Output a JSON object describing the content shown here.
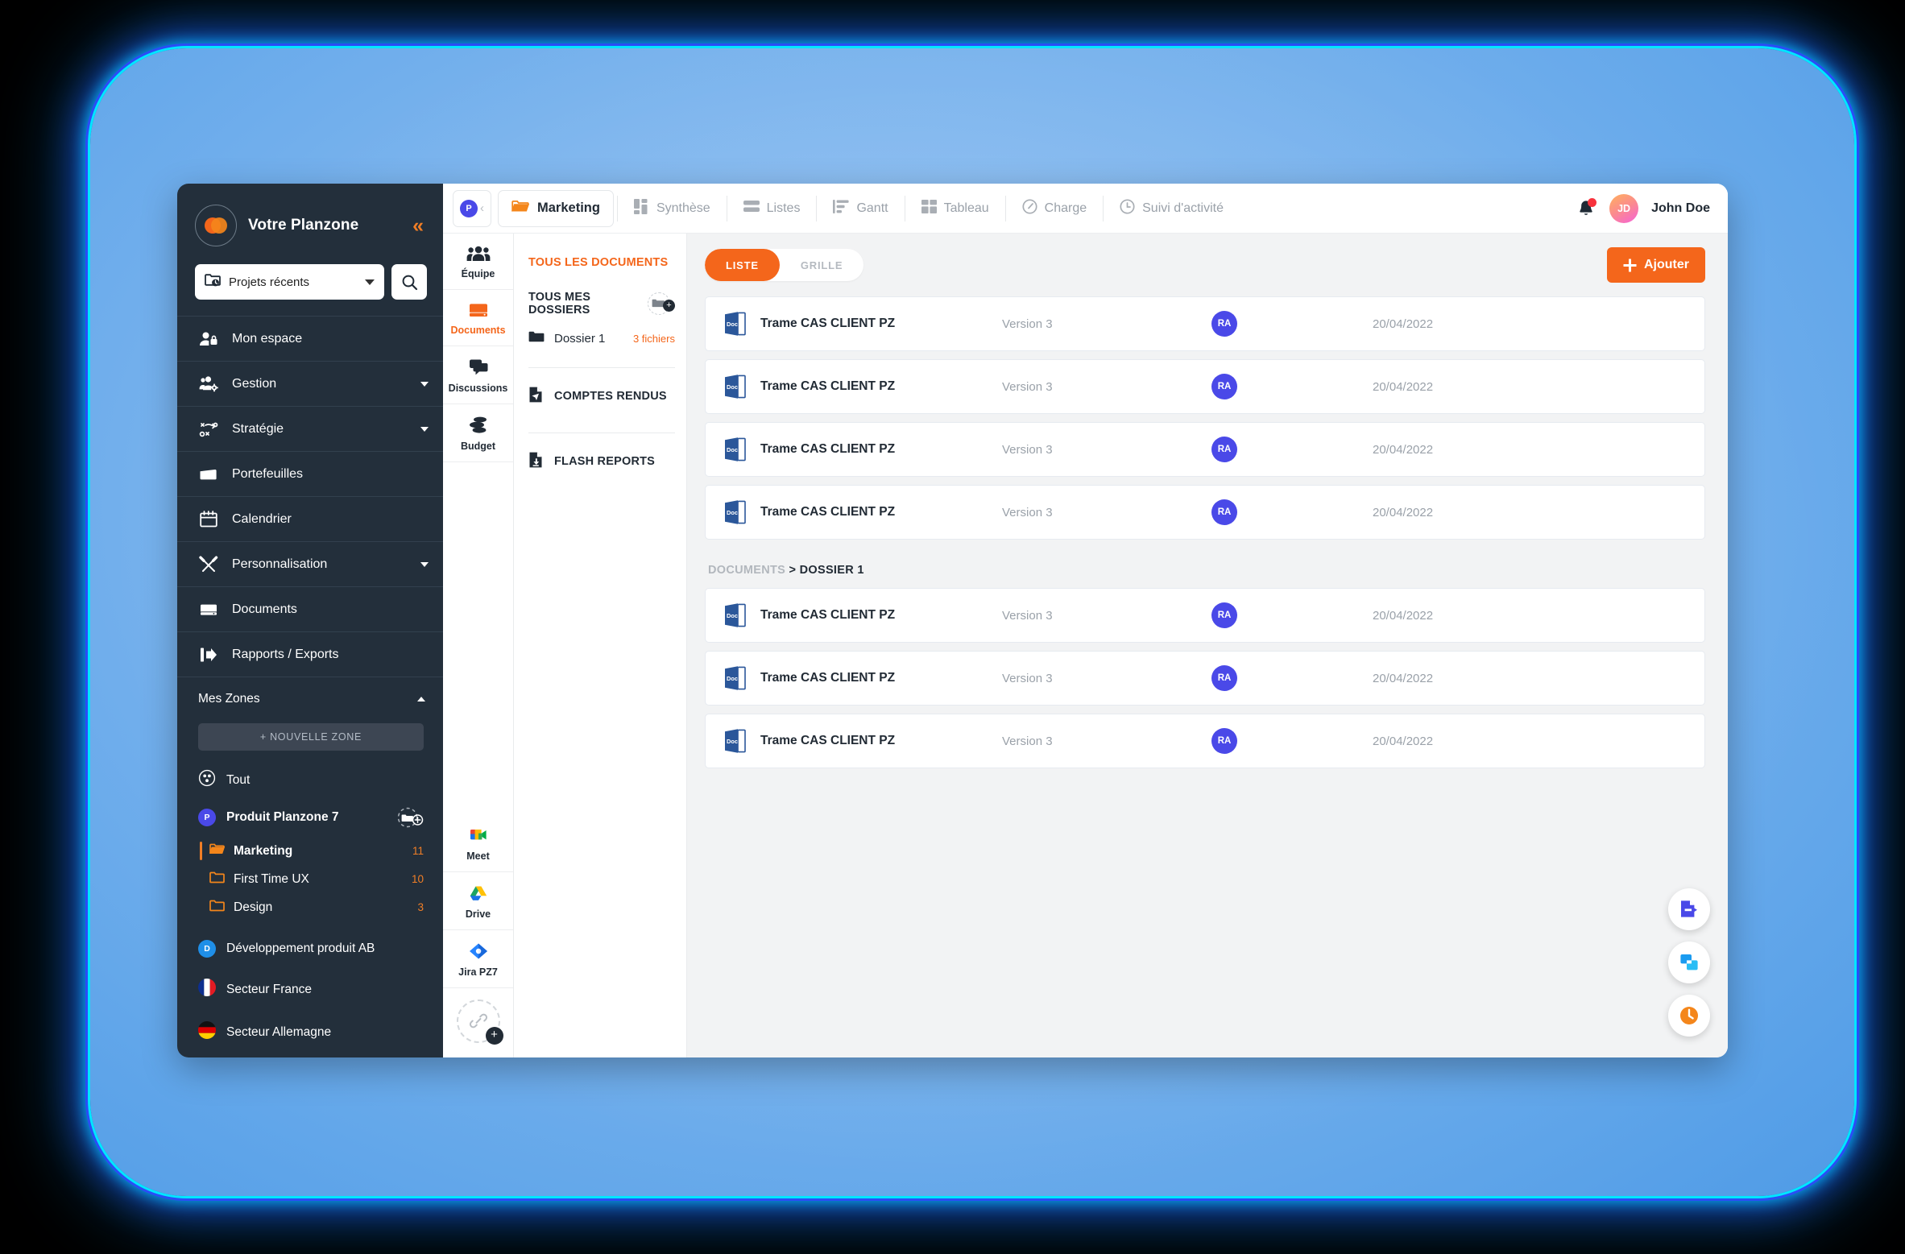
{
  "sidebar": {
    "brand_title": "Votre Planzone",
    "collapse_icon": "double-chevron-left-icon",
    "project_select": {
      "value": "Projets récents"
    },
    "search_placeholder": "Rechercher",
    "items": [
      {
        "label": "Mon espace",
        "icon": "user-lock-icon",
        "expandable": false
      },
      {
        "label": "Gestion",
        "icon": "users-gear-icon",
        "expandable": true
      },
      {
        "label": "Stratégie",
        "icon": "strategy-icon",
        "expandable": true
      },
      {
        "label": "Portefeuilles",
        "icon": "briefcase-icon",
        "expandable": false
      },
      {
        "label": "Calendrier",
        "icon": "calendar-icon",
        "expandable": false
      },
      {
        "label": "Personnalisation",
        "icon": "tools-icon",
        "expandable": true
      },
      {
        "label": "Documents",
        "icon": "documents-icon",
        "expandable": false
      },
      {
        "label": "Rapports / Exports",
        "icon": "export-icon",
        "expandable": false
      }
    ],
    "zones_header": "Mes Zones",
    "new_zone_label": "+ NOUVELLE ZONE",
    "zones": [
      {
        "label": "Tout",
        "badge": "",
        "badge_color": "",
        "type": "all"
      },
      {
        "label": "Produit Planzone 7",
        "badge": "P",
        "badge_color": "#4a49e8",
        "type": "project",
        "has_add": true
      },
      {
        "label": "Développement produit AB",
        "badge": "D",
        "badge_color": "#1f8fe8",
        "type": "project"
      },
      {
        "label": "Secteur France",
        "badge": "",
        "badge_color": "",
        "type": "flag-fr"
      },
      {
        "label": "Secteur Allemagne",
        "badge": "",
        "badge_color": "",
        "type": "flag-de"
      }
    ],
    "folders": [
      {
        "label": "Marketing",
        "count": "11",
        "active": true
      },
      {
        "label": "First Time UX",
        "count": "10",
        "active": false
      },
      {
        "label": "Design",
        "count": "3",
        "active": false
      }
    ]
  },
  "topnav": {
    "chip_initial": "P",
    "chip_chevron": "‹",
    "active_tab": "Marketing",
    "tabs": [
      {
        "label": "Synthèse",
        "icon": "dashboard-icon"
      },
      {
        "label": "Listes",
        "icon": "list-icon"
      },
      {
        "label": "Gantt",
        "icon": "gantt-icon"
      },
      {
        "label": "Tableau",
        "icon": "board-icon"
      },
      {
        "label": "Charge",
        "icon": "gauge-icon"
      },
      {
        "label": "Suivi d'activité",
        "icon": "clock-icon"
      }
    ],
    "notifications_icon": "bell-icon",
    "has_notification": true,
    "user_initials": "JD",
    "user_name": "John Doe"
  },
  "rail": {
    "items": [
      {
        "label": "Équipe",
        "icon": "team-icon",
        "active": false
      },
      {
        "label": "Documents",
        "icon": "documents-icon",
        "active": true
      },
      {
        "label": "Discussions",
        "icon": "chat-icon",
        "active": false
      },
      {
        "label": "Budget",
        "icon": "coins-icon",
        "active": false
      }
    ],
    "apps": [
      {
        "label": "Meet",
        "icon": "google-meet-icon"
      },
      {
        "label": "Drive",
        "icon": "google-drive-icon"
      },
      {
        "label": "Jira PZ7",
        "icon": "jira-icon"
      }
    ],
    "add_app_icon": "link-plus-icon"
  },
  "tree": {
    "all_documents": "TOUS LES DOCUMENTS",
    "all_folders": "TOUS MES DOSSIERS",
    "add_folder_icon": "add-folder-icon",
    "folders": [
      {
        "name": "Dossier 1",
        "count": "3 fichiers"
      }
    ],
    "links": [
      {
        "label": "COMPTES RENDUS",
        "icon": "report-send-icon"
      },
      {
        "label": "FLASH REPORTS",
        "icon": "report-download-icon"
      }
    ]
  },
  "toolbar": {
    "view_list": "LISTE",
    "view_grid": "GRILLE",
    "add_label": "Ajouter",
    "add_icon": "plus-icon"
  },
  "documents": {
    "root_rows": [
      {
        "icon": "word-doc-icon",
        "name": "Trame CAS CLIENT PZ",
        "version": "Version 3",
        "author": "RA",
        "date": "20/04/2022"
      },
      {
        "icon": "word-doc-icon",
        "name": "Trame CAS CLIENT PZ",
        "version": "Version 3",
        "author": "RA",
        "date": "20/04/2022"
      },
      {
        "icon": "word-doc-icon",
        "name": "Trame CAS CLIENT PZ",
        "version": "Version 3",
        "author": "RA",
        "date": "20/04/2022"
      },
      {
        "icon": "word-doc-icon",
        "name": "Trame CAS CLIENT PZ",
        "version": "Version 3",
        "author": "RA",
        "date": "20/04/2022"
      }
    ],
    "group_breadcrumb_parent": "DOCUMENTS",
    "group_breadcrumb_sep": ">",
    "group_breadcrumb_current": "DOSSIER 1",
    "group_rows": [
      {
        "icon": "word-doc-icon",
        "name": "Trame CAS CLIENT PZ",
        "version": "Version 3",
        "author": "RA",
        "date": "20/04/2022"
      },
      {
        "icon": "word-doc-icon",
        "name": "Trame CAS CLIENT PZ",
        "version": "Version 3",
        "author": "RA",
        "date": "20/04/2022"
      },
      {
        "icon": "word-doc-icon",
        "name": "Trame CAS CLIENT PZ",
        "version": "Version 3",
        "author": "RA",
        "date": "20/04/2022"
      }
    ]
  },
  "fabs": [
    {
      "icon": "document-export-icon",
      "color": "#4a49e8"
    },
    {
      "icon": "duplicate-icon",
      "color": "#26a9f0"
    },
    {
      "icon": "clock-history-icon",
      "color": "#f4861b"
    }
  ],
  "colors": {
    "accent": "#f4661b",
    "sidebar_bg": "#232f3b",
    "content_bg": "#f2f3f4",
    "indigo": "#4a49e8"
  }
}
